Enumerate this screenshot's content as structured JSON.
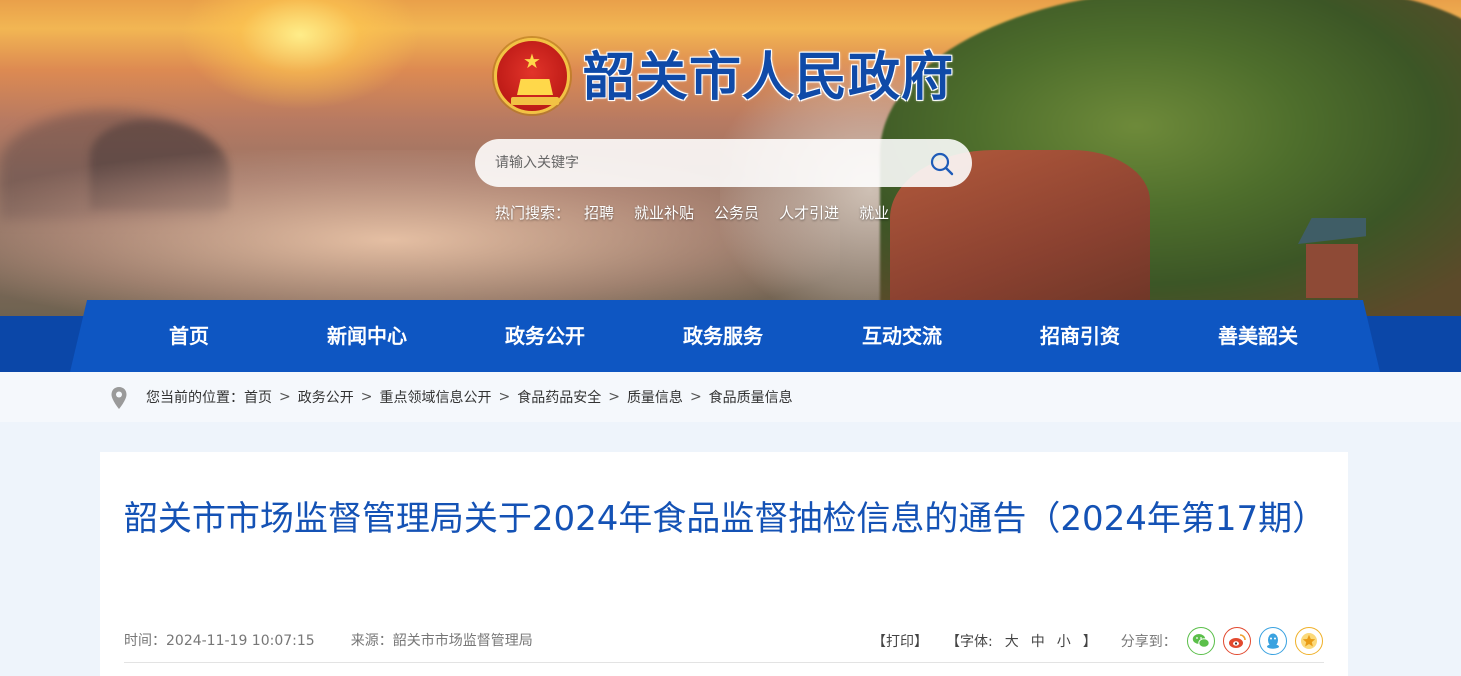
{
  "site": {
    "title": "韶关市人民政府"
  },
  "search": {
    "placeholder": "请输入关键字"
  },
  "hot_search": {
    "label": "热门搜索：",
    "keywords": [
      "招聘",
      "就业补贴",
      "公务员",
      "人才引进",
      "就业"
    ]
  },
  "nav": {
    "items": [
      "首页",
      "新闻中心",
      "政务公开",
      "政务服务",
      "互动交流",
      "招商引资",
      "善美韶关"
    ],
    "active": "政务公开"
  },
  "breadcrumb": {
    "prefix": "您当前的位置：",
    "items": [
      "首页",
      "政务公开",
      "重点领域信息公开",
      "食品药品安全",
      "质量信息",
      "食品质量信息"
    ],
    "separator": ">"
  },
  "article": {
    "title": "韶关市市场监督管理局关于2024年食品监督抽检信息的通告（2024年第17期）",
    "time": "时间：2024-11-19 10:07:15",
    "source": "来源：韶关市市场监督管理局"
  },
  "tools": {
    "print": "【打印】",
    "font_prefix": "【字体:",
    "font_large": "大",
    "font_medium": "中",
    "font_small": "小",
    "font_suffix": "】",
    "share_label": "分享到："
  },
  "share": [
    {
      "name": "wechat-icon",
      "color": "#5bbf4a"
    },
    {
      "name": "weibo-icon",
      "color": "#e2492f"
    },
    {
      "name": "qq-icon",
      "color": "#3aa2e0"
    },
    {
      "name": "qzone-icon",
      "color": "#f0b12a"
    }
  ],
  "colors": {
    "nav_blue": "#0e56c2",
    "title_blue": "#1452b5"
  }
}
